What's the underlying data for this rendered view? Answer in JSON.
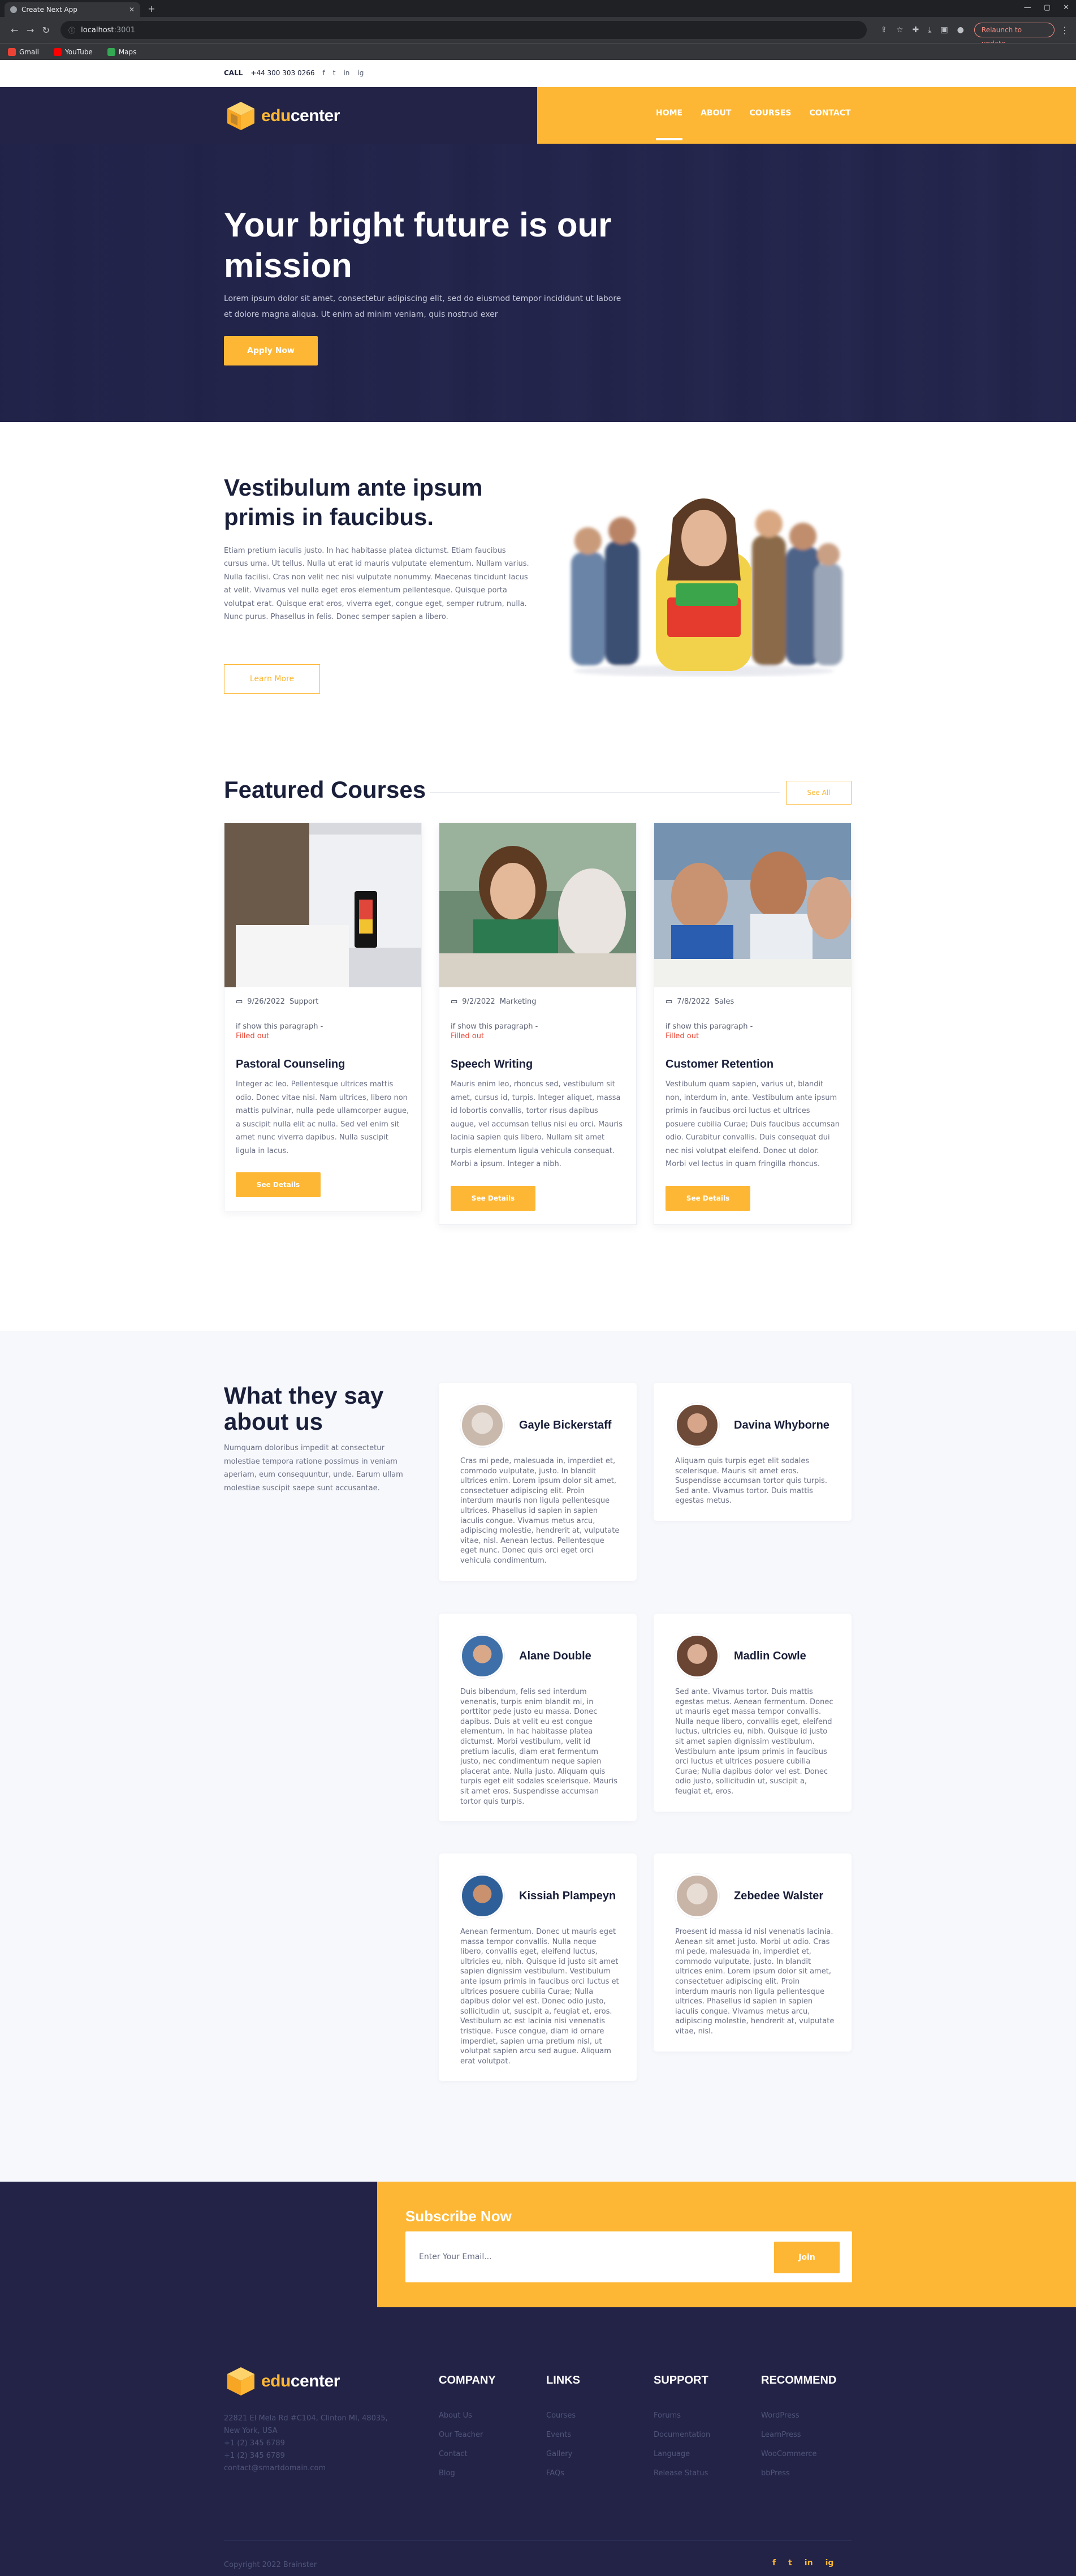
{
  "browser": {
    "tab_title": "Create Next App",
    "url_host": "localhost",
    "url_port": ":3001",
    "relaunch_label": "Relaunch to update",
    "bookmarks": [
      {
        "label": "Gmail",
        "color": "#ea4335"
      },
      {
        "label": "YouTube",
        "color": "#ff0000"
      },
      {
        "label": "Maps",
        "color": "#34a853"
      }
    ]
  },
  "topbar": {
    "call_label": "CALL",
    "phone": "+44 300 303 0266",
    "socials": [
      "f",
      "t",
      "in",
      "ig"
    ]
  },
  "nav": {
    "logo_edu": "edu",
    "logo_center": "center",
    "links": [
      "HOME",
      "ABOUT",
      "COURSES",
      "CONTACT"
    ],
    "active": "HOME"
  },
  "hero": {
    "title": "Your bright future is our mission",
    "subtitle": "Lorem ipsum dolor sit amet, consectetur adipiscing elit, sed do eiusmod tempor incididunt ut labore et dolore magna aliqua. Ut enim ad minim veniam, quis nostrud exer",
    "button": "Apply Now"
  },
  "about": {
    "title": "Vestibulum ante ipsum primis in faucibus.",
    "text": "Etiam pretium iaculis justo. In hac habitasse platea dictumst. Etiam faucibus cursus urna. Ut tellus. Nulla ut erat id mauris vulputate elementum. Nullam varius. Nulla facilisi. Cras non velit nec nisi vulputate nonummy. Maecenas tincidunt lacus at velit. Vivamus vel nulla eget eros elementum pellentesque. Quisque porta volutpat erat. Quisque erat eros, viverra eget, congue eget, semper rutrum, nulla. Nunc purus. Phasellus in felis. Donec semper sapien a libero.",
    "button": "Learn More"
  },
  "courses": {
    "title": "Featured Courses",
    "view_all": "See All",
    "items": [
      {
        "date": "9/26/2022",
        "category": "Support",
        "note": "if show this paragraph -",
        "filled": "Filled out",
        "name": "Pastoral Counseling",
        "desc": "Integer ac leo. Pellentesque ultrices mattis odio. Donec vitae nisi. Nam ultrices, libero non mattis pulvinar, nulla pede ullamcorper augue, a suscipit nulla elit ac nulla. Sed vel enim sit amet nunc viverra dapibus. Nulla suscipit ligula in lacus.",
        "button": "See Details"
      },
      {
        "date": "9/2/2022",
        "category": "Marketing",
        "note": "if show this paragraph -",
        "filled": "Filled out",
        "name": "Speech Writing",
        "desc": "Mauris enim leo, rhoncus sed, vestibulum sit amet, cursus id, turpis. Integer aliquet, massa id lobortis convallis, tortor risus dapibus augue, vel accumsan tellus nisi eu orci. Mauris lacinia sapien quis libero. Nullam sit amet turpis elementum ligula vehicula consequat. Morbi a ipsum. Integer a nibh.",
        "button": "See Details"
      },
      {
        "date": "7/8/2022",
        "category": "Sales",
        "note": "if show this paragraph -",
        "filled": "Filled out",
        "name": "Customer Retention",
        "desc": "Vestibulum quam sapien, varius ut, blandit non, interdum in, ante. Vestibulum ante ipsum primis in faucibus orci luctus et ultrices posuere cubilia Curae; Duis faucibus accumsan odio. Curabitur convallis. Duis consequat dui nec nisi volutpat eleifend. Donec ut dolor. Morbi vel lectus in quam fringilla rhoncus.",
        "button": "See Details"
      }
    ]
  },
  "testimonials": {
    "title": "What they say about us",
    "text": "Numquam doloribus impedit at consectetur molestiae tempora ratione possimus in veniam aperiam, eum consequuntur, unde. Earum ullam molestiae suscipit saepe sunt accusantae.",
    "items": [
      {
        "name": "Gayle Bickerstaff",
        "quote": "Cras mi pede, malesuada in, imperdiet et, commodo vulputate, justo. In blandit ultrices enim. Lorem ipsum dolor sit amet, consectetuer adipiscing elit. Proin interdum mauris non ligula pellentesque ultrices. Phasellus id sapien in sapien iaculis congue. Vivamus metus arcu, adipiscing molestie, hendrerit at, vulputate vitae, nisl. Aenean lectus. Pellentesque eget nunc. Donec quis orci eget orci vehicula condimentum."
      },
      {
        "name": "Davina Whyborne",
        "quote": "Aliquam quis turpis eget elit sodales scelerisque. Mauris sit amet eros. Suspendisse accumsan tortor quis turpis. Sed ante. Vivamus tortor. Duis mattis egestas metus."
      },
      {
        "name": "Alane Double",
        "quote": "Duis bibendum, felis sed interdum venenatis, turpis enim blandit mi, in porttitor pede justo eu massa. Donec dapibus. Duis at velit eu est congue elementum. In hac habitasse platea dictumst. Morbi vestibulum, velit id pretium iaculis, diam erat fermentum justo, nec condimentum neque sapien placerat ante. Nulla justo. Aliquam quis turpis eget elit sodales scelerisque. Mauris sit amet eros. Suspendisse accumsan tortor quis turpis."
      },
      {
        "name": "Madlin Cowle",
        "quote": "Sed ante. Vivamus tortor. Duis mattis egestas metus. Aenean fermentum. Donec ut mauris eget massa tempor convallis. Nulla neque libero, convallis eget, eleifend luctus, ultricies eu, nibh. Quisque id justo sit amet sapien dignissim vestibulum. Vestibulum ante ipsum primis in faucibus orci luctus et ultrices posuere cubilia Curae; Nulla dapibus dolor vel est. Donec odio justo, sollicitudin ut, suscipit a, feugiat et, eros."
      },
      {
        "name": "Kissiah Plampeyn",
        "quote": "Aenean fermentum. Donec ut mauris eget massa tempor convallis. Nulla neque libero, convallis eget, eleifend luctus, ultricies eu, nibh. Quisque id justo sit amet sapien dignissim vestibulum. Vestibulum ante ipsum primis in faucibus orci luctus et ultrices posuere cubilia Curae; Nulla dapibus dolor vel est. Donec odio justo, sollicitudin ut, suscipit a, feugiat et, eros. Vestibulum ac est lacinia nisi venenatis tristique. Fusce congue, diam id ornare imperdiet, sapien urna pretium nisl, ut volutpat sapien arcu sed augue. Aliquam erat volutpat."
      },
      {
        "name": "Zebedee Walster",
        "quote": "Proesent id massa id nisl venenatis lacinia. Aenean sit amet justo. Morbi ut odio. Cras mi pede, malesuada in, imperdiet et, commodo vulputate, justo. In blandit ultrices enim. Lorem ipsum dolor sit amet, consectetuer adipiscing elit. Proin interdum mauris non ligula pellentesque ultrices. Phasellus id sapien in sapien iaculis congue. Vivamus metus arcu, adipiscing molestie, hendrerit at, vulputate vitae, nisl."
      }
    ]
  },
  "subscribe": {
    "title": "Subscribe Now",
    "placeholder": "Enter Your Email...",
    "button": "Join"
  },
  "footer": {
    "address": [
      "22821 El Mela Rd #C104, Clinton MI, 48035, New York, USA",
      "+1 (2) 345 6789",
      "+1 (2) 345 6789",
      "contact@smartdomain.com"
    ],
    "columns": [
      {
        "title": "COMPANY",
        "links": [
          "About Us",
          "Our Teacher",
          "Contact",
          "Blog"
        ]
      },
      {
        "title": "LINKS",
        "links": [
          "Courses",
          "Events",
          "Gallery",
          "FAQs"
        ]
      },
      {
        "title": "SUPPORT",
        "links": [
          "Forums",
          "Documentation",
          "Language",
          "Release Status"
        ]
      },
      {
        "title": "RECOMMEND",
        "links": [
          "WordPress",
          "LearnPress",
          "WooCommerce",
          "bbPress"
        ]
      }
    ],
    "copyright": "Copyright 2022 Brainster",
    "socials": [
      "f",
      "t",
      "in",
      "ig"
    ]
  },
  "colors": {
    "accent": "#fdb734",
    "navy": "#232347",
    "text": "#1a1f3a",
    "muted": "#6b7086"
  }
}
